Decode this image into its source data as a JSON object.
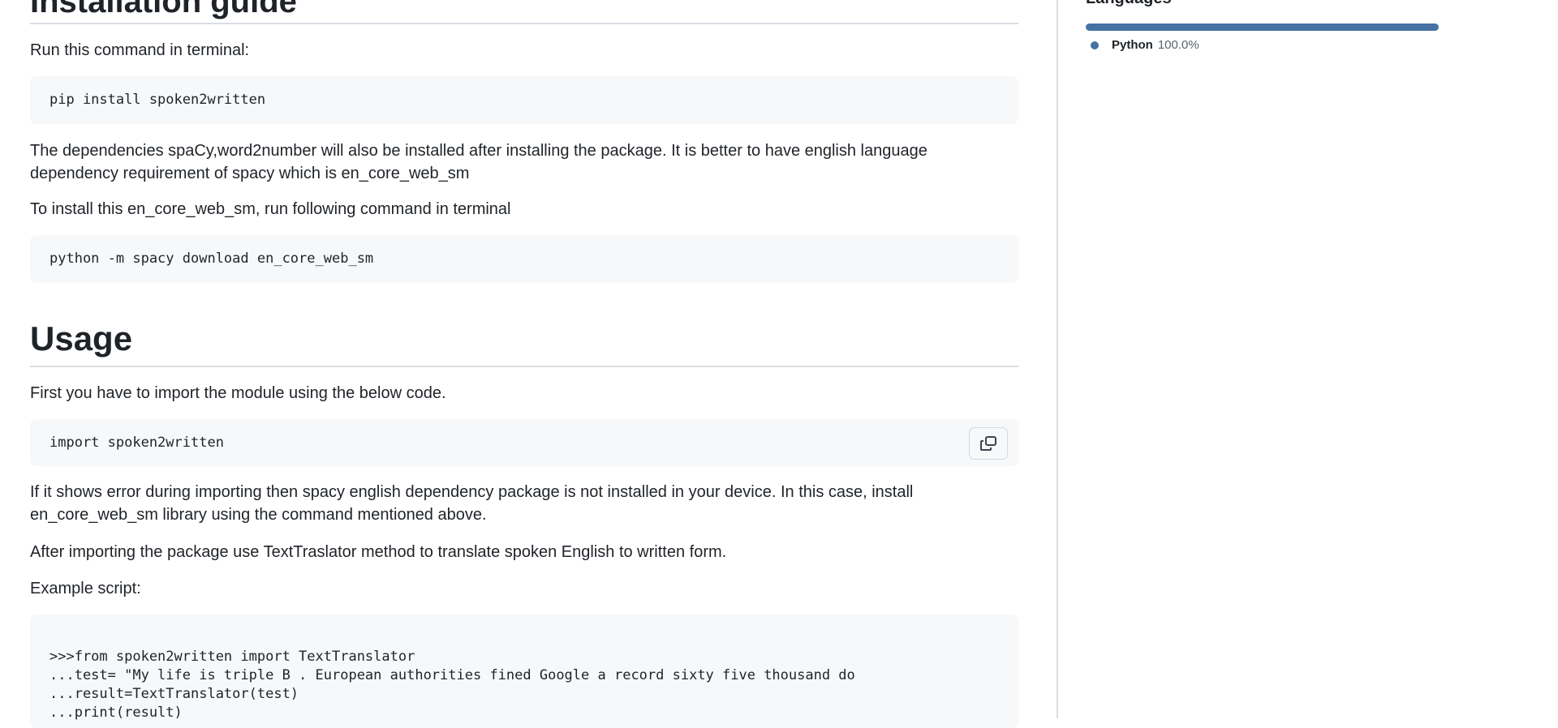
{
  "readme": {
    "install_heading": "Installation guide",
    "run_cmd_text": "Run this command in terminal:",
    "pip_cmd": "pip install spoken2written",
    "deps_text": "The dependencies spaCy,word2number will also be installed after installing the package. It is better to have english language dependency requirement of spacy which is en_core_web_sm",
    "install_model_text": "To install this en_core_web_sm, run following command in terminal",
    "spacy_cmd": "python -m spacy download en_core_web_sm",
    "usage_heading": "Usage",
    "import_text": "First you have to import the module using the below code.",
    "import_cmd": "import spoken2written",
    "error_text": "If it shows error during importing then spacy english dependency package is not installed in your device. In this case, install en_core_web_sm library using the command mentioned above.",
    "after_text": "After importing the package use TextTraslator method to translate spoken English to written form.",
    "example_label": "Example script:",
    "example_lines": [
      ">>>from spoken2written import TextTranslator",
      "...test= \"My life is triple B . European authorities fined Google a record sixty five thousand do",
      "...result=TextTranslator(test)",
      "...print(result)"
    ]
  },
  "sidebar": {
    "languages_heading": "Languages",
    "languages": [
      {
        "name": "Python",
        "percent": "100.0%",
        "fraction": 1.0,
        "color": "#3572A5"
      }
    ]
  }
}
